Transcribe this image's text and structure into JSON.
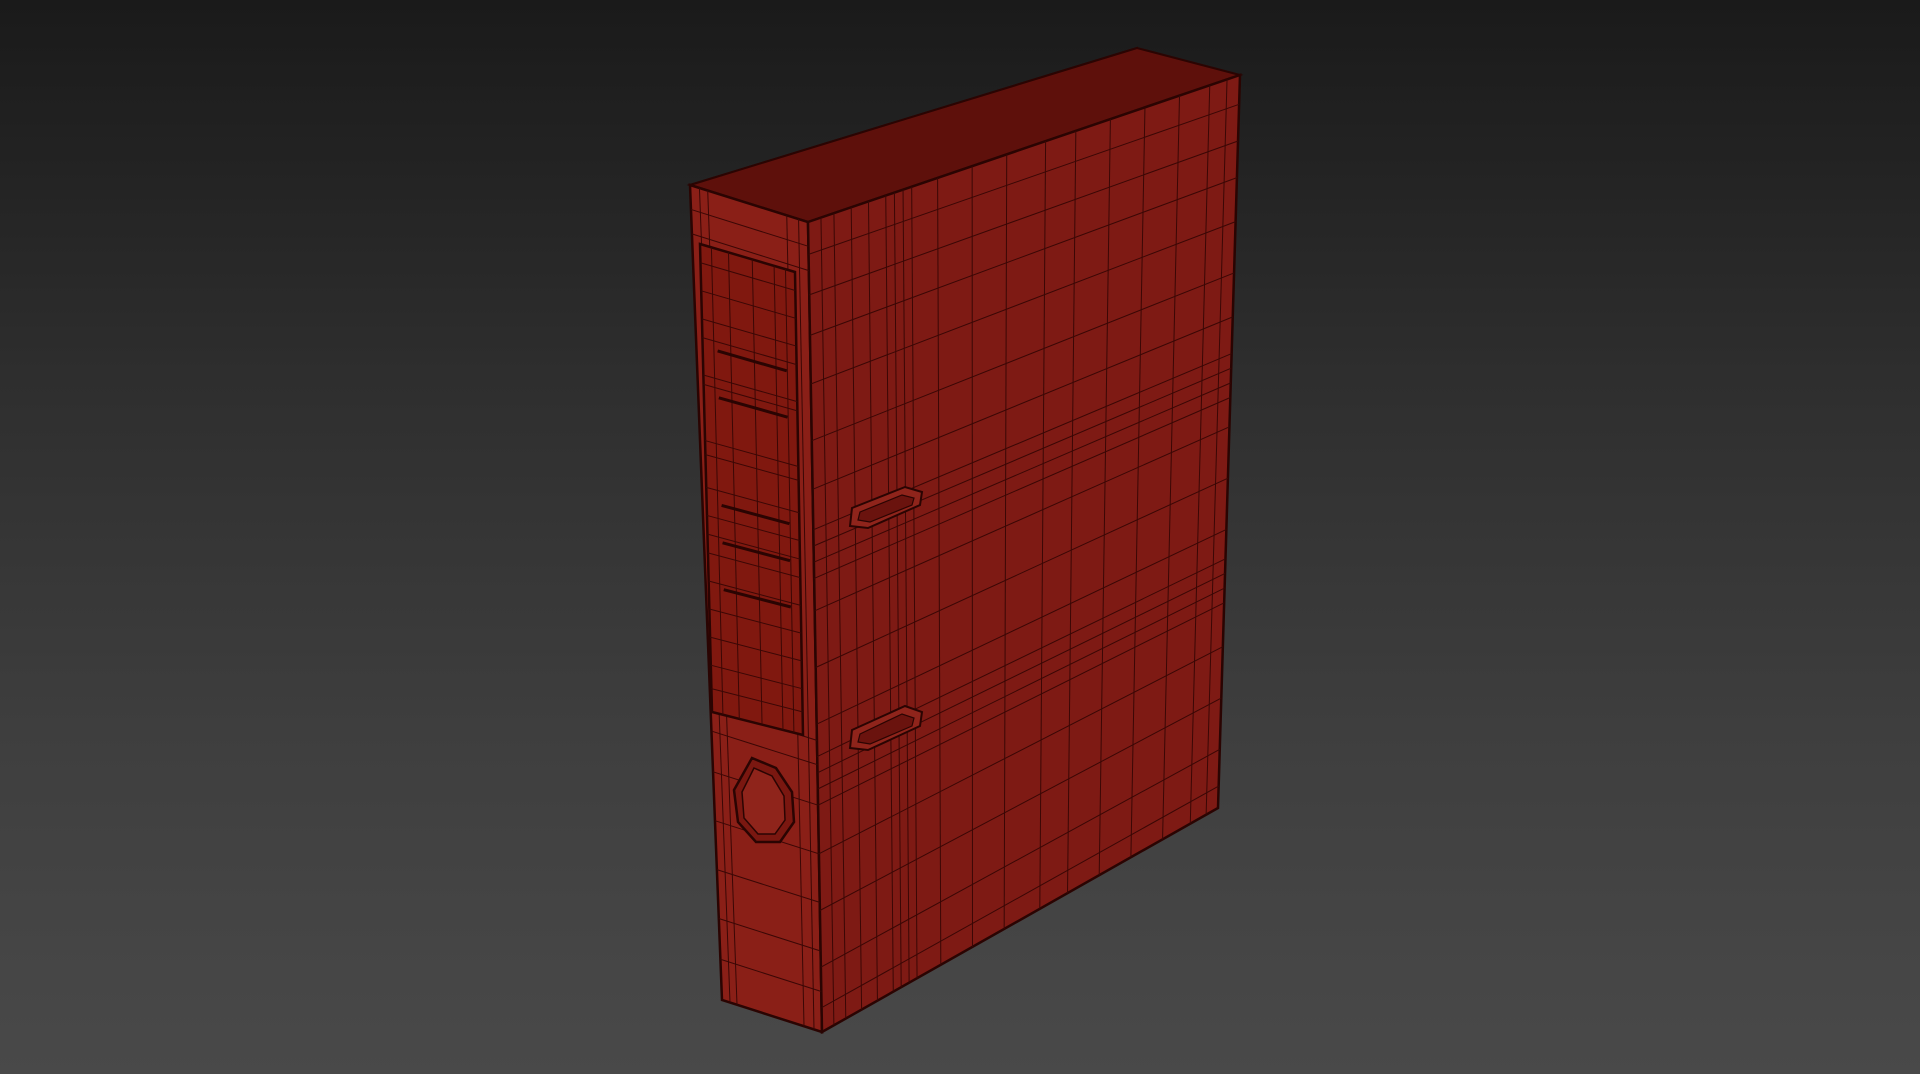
{
  "viewport": {
    "background_top": "#1a1a1a",
    "background_bottom": "#494949"
  },
  "model": {
    "object": "lever-arch-binder",
    "display_mode": "wireframe-on-shaded",
    "colors": {
      "cover": "#7e1a14",
      "cover_light": "#8e221a",
      "spine": "#8a1f17",
      "inside": "#6a130e",
      "edge_top": "#9a2a20",
      "wire": "#3a0705",
      "wire_strong": "#2a0402"
    }
  }
}
